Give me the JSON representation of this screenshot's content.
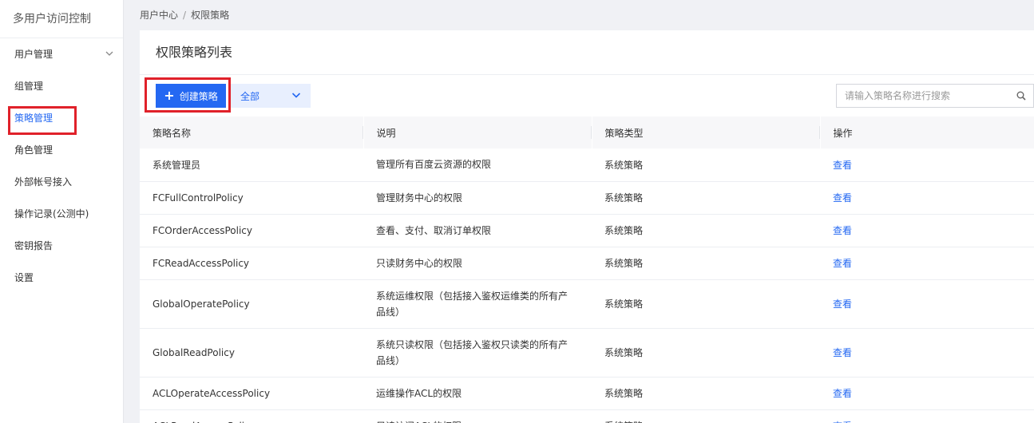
{
  "sidebar": {
    "title": "多用户访问控制",
    "items": [
      {
        "label": "用户管理",
        "has_chevron": true
      },
      {
        "label": "组管理"
      },
      {
        "label": "策略管理",
        "active": true
      },
      {
        "label": "角色管理"
      },
      {
        "label": "外部帐号接入"
      },
      {
        "label": "操作记录(公测中)"
      },
      {
        "label": "密钥报告"
      },
      {
        "label": "设置"
      }
    ]
  },
  "breadcrumb": {
    "parent": "用户中心",
    "separator": "/",
    "current": "权限策略"
  },
  "main": {
    "title": "权限策略列表",
    "create_button": "创建策略",
    "filter": {
      "selected": "全部"
    },
    "search": {
      "placeholder": "请输入策略名称进行搜索",
      "value": ""
    },
    "table": {
      "headers": [
        "策略名称",
        "说明",
        "策略类型",
        "操作"
      ],
      "rows": [
        {
          "name": "系统管理员",
          "desc": "管理所有百度云资源的权限",
          "type": "系统策略",
          "action": "查看"
        },
        {
          "name": "FCFullControlPolicy",
          "desc": "管理财务中心的权限",
          "type": "系统策略",
          "action": "查看"
        },
        {
          "name": "FCOrderAccessPolicy",
          "desc": "查看、支付、取消订单权限",
          "type": "系统策略",
          "action": "查看"
        },
        {
          "name": "FCReadAccessPolicy",
          "desc": "只读财务中心的权限",
          "type": "系统策略",
          "action": "查看"
        },
        {
          "name": "GlobalOperatePolicy",
          "desc": "系统运维权限（包括接入鉴权运维类的所有产品线）",
          "type": "系统策略",
          "action": "查看"
        },
        {
          "name": "GlobalReadPolicy",
          "desc": "系统只读权限（包括接入鉴权只读类的所有产品线）",
          "type": "系统策略",
          "action": "查看"
        },
        {
          "name": "ACLOperateAccessPolicy",
          "desc": "运维操作ACL的权限",
          "type": "系统策略",
          "action": "查看"
        },
        {
          "name": "ACLReadAccessPolicy",
          "desc": "只读访问ACL的权限",
          "type": "系统策略",
          "action": "查看"
        }
      ]
    }
  },
  "colors": {
    "accent": "#2468f2",
    "highlight": "#e0212a"
  }
}
